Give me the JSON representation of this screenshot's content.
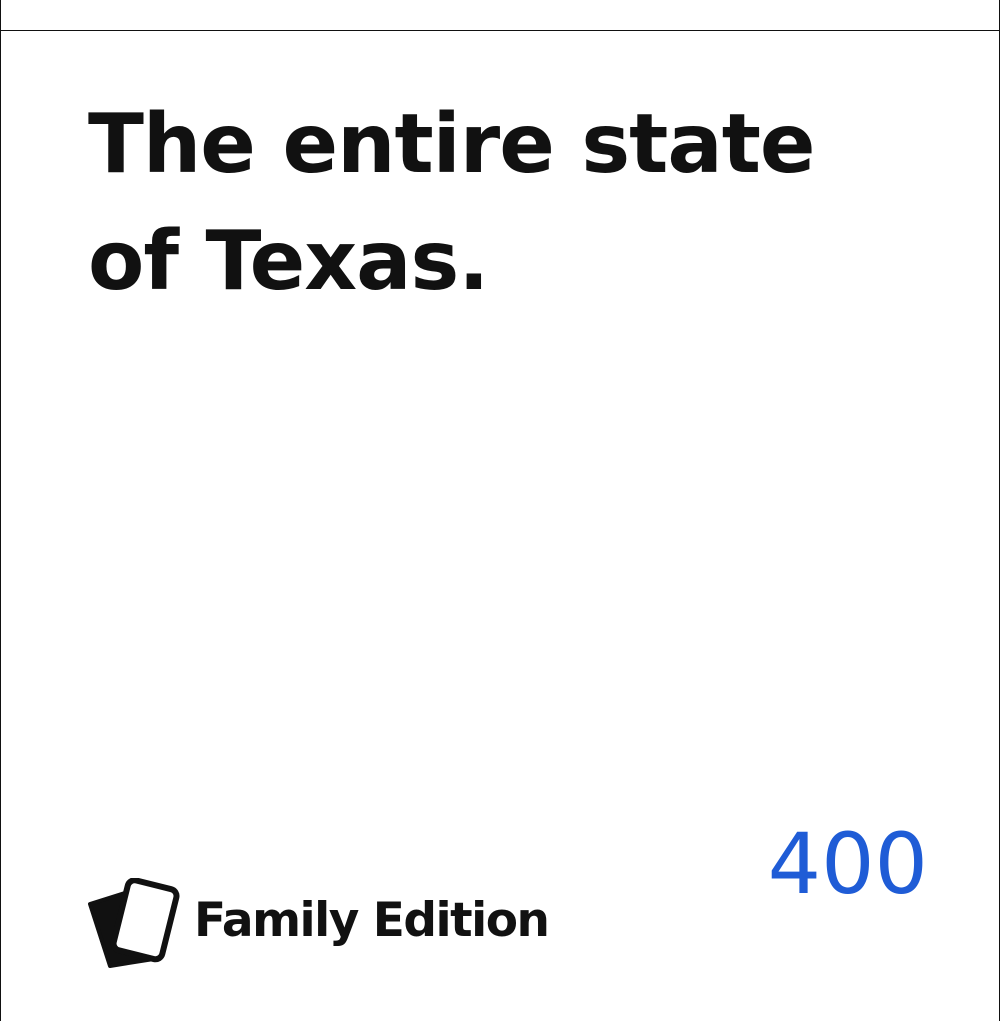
{
  "card": {
    "text": "The entire state of Texas.",
    "score": "400",
    "score_color": "#1f5cd6",
    "brand_icon": "card-stack-icon",
    "brand_name": "Family Edition"
  }
}
